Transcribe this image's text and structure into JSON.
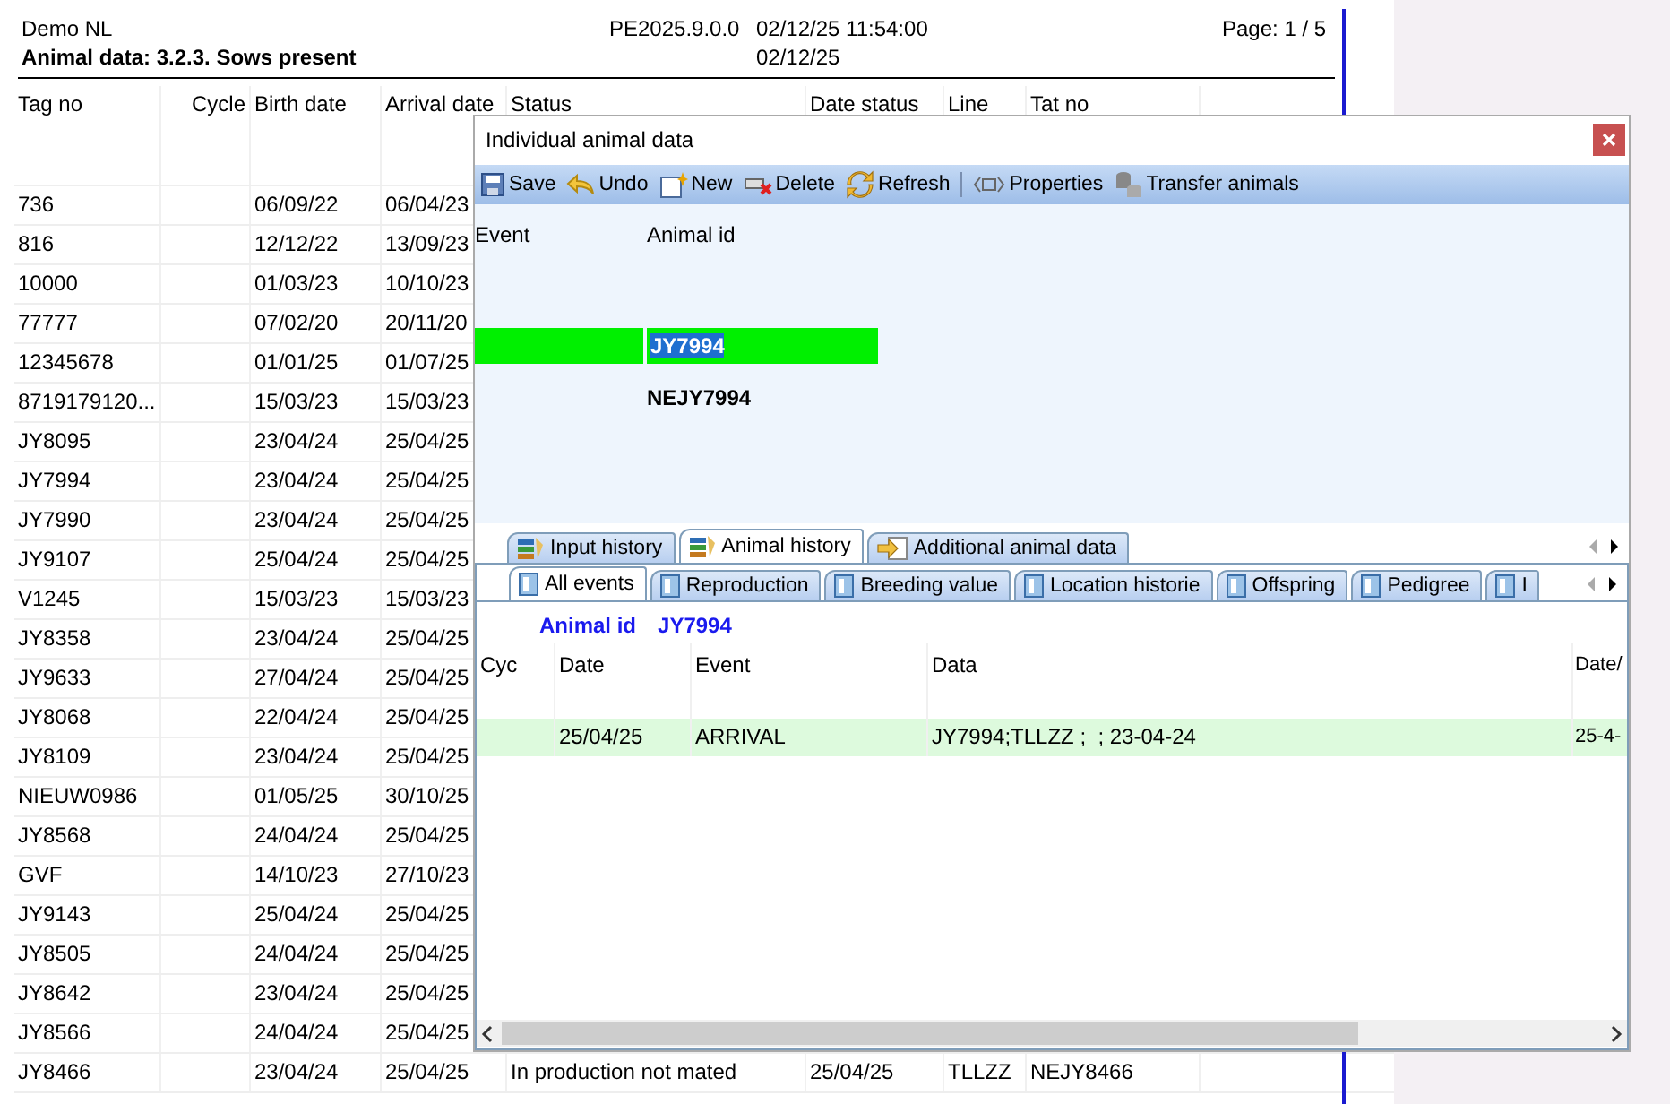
{
  "report": {
    "company": "Demo NL",
    "title": "Animal data: 3.2.3. Sows present",
    "version": "PE2025.9.0.0",
    "printed": "02/12/25 11:54:00",
    "date": "02/12/25",
    "page": "Page: 1 / 5",
    "columns": [
      "Tag no",
      "Cycle",
      "Birth date",
      "Arrival date",
      "Status",
      "Date status",
      "Line",
      "Tat no"
    ],
    "rows": [
      {
        "tag_no": "736",
        "birth_date": "06/09/22",
        "arrival_date": "06/04/23"
      },
      {
        "tag_no": "816",
        "birth_date": "12/12/22",
        "arrival_date": "13/09/23"
      },
      {
        "tag_no": "10000",
        "birth_date": "01/03/23",
        "arrival_date": "10/10/23"
      },
      {
        "tag_no": "77777",
        "birth_date": "07/02/20",
        "arrival_date": "20/11/20"
      },
      {
        "tag_no": "12345678",
        "birth_date": "01/01/25",
        "arrival_date": "01/07/25"
      },
      {
        "tag_no": "8719179120...",
        "birth_date": "15/03/23",
        "arrival_date": "15/03/23"
      },
      {
        "tag_no": "JY8095",
        "birth_date": "23/04/24",
        "arrival_date": "25/04/25"
      },
      {
        "tag_no": "JY7994",
        "birth_date": "23/04/24",
        "arrival_date": "25/04/25"
      },
      {
        "tag_no": "JY7990",
        "birth_date": "23/04/24",
        "arrival_date": "25/04/25"
      },
      {
        "tag_no": "JY9107",
        "birth_date": "25/04/24",
        "arrival_date": "25/04/25"
      },
      {
        "tag_no": "V1245",
        "birth_date": "15/03/23",
        "arrival_date": "15/03/23"
      },
      {
        "tag_no": "JY8358",
        "birth_date": "23/04/24",
        "arrival_date": "25/04/25"
      },
      {
        "tag_no": "JY9633",
        "birth_date": "27/04/24",
        "arrival_date": "25/04/25"
      },
      {
        "tag_no": "JY8068",
        "birth_date": "22/04/24",
        "arrival_date": "25/04/25"
      },
      {
        "tag_no": "JY8109",
        "birth_date": "23/04/24",
        "arrival_date": "25/04/25"
      },
      {
        "tag_no": "NIEUW0986",
        "birth_date": "01/05/25",
        "arrival_date": "30/10/25"
      },
      {
        "tag_no": "JY8568",
        "birth_date": "24/04/24",
        "arrival_date": "25/04/25"
      },
      {
        "tag_no": "GVF",
        "birth_date": "14/10/23",
        "arrival_date": "27/10/23"
      },
      {
        "tag_no": "JY9143",
        "birth_date": "25/04/24",
        "arrival_date": "25/04/25"
      },
      {
        "tag_no": "JY8505",
        "birth_date": "24/04/24",
        "arrival_date": "25/04/25"
      },
      {
        "tag_no": "JY8642",
        "birth_date": "23/04/24",
        "arrival_date": "25/04/25"
      },
      {
        "tag_no": "JY8566",
        "birth_date": "24/04/24",
        "arrival_date": "25/04/25"
      },
      {
        "tag_no": "JY8466",
        "birth_date": "23/04/24",
        "arrival_date": "25/04/25",
        "status": "In production not mated",
        "date_status": "25/04/25",
        "line": "TLLZZ",
        "tat_no": "NEJY8466"
      }
    ]
  },
  "dialog": {
    "title": "Individual animal data",
    "toolbar": [
      {
        "kind": "save",
        "label": "Save",
        "separator_before": false
      },
      {
        "kind": "undo",
        "label": "Undo",
        "separator_before": false
      },
      {
        "kind": "new",
        "label": "New",
        "separator_before": false
      },
      {
        "kind": "delete",
        "label": "Delete",
        "separator_before": false
      },
      {
        "kind": "refresh",
        "label": "Refresh",
        "separator_before": false
      },
      {
        "kind": "properties",
        "label": "Properties",
        "separator_before": true
      },
      {
        "kind": "transfer",
        "label": "Transfer animals",
        "separator_before": false
      }
    ],
    "entry": {
      "columns": [
        "Event",
        "Animal id"
      ],
      "rows": [
        {
          "kind": "input",
          "animal_id": "JY7994"
        },
        {
          "kind": "summary",
          "animal_id": "NEJY7994"
        }
      ]
    },
    "tabs": [
      {
        "kind": "books",
        "label": "Input history",
        "selected": false
      },
      {
        "kind": "books",
        "label": "Animal history",
        "selected": true
      },
      {
        "kind": "arrow",
        "label": "Additional animal data",
        "selected": false
      }
    ],
    "subtabs": [
      {
        "label": "All events",
        "selected": true
      },
      {
        "label": "Reproduction",
        "selected": false
      },
      {
        "label": "Breeding value",
        "selected": false
      },
      {
        "label": "Location historie",
        "selected": false
      },
      {
        "label": "Offspring",
        "selected": false
      },
      {
        "label": "Pedigree",
        "selected": false
      },
      {
        "label": "I",
        "selected": false
      }
    ],
    "history": {
      "animal_label": "Animal id",
      "animal_id": "JY7994",
      "columns": [
        "Cyc",
        "Date",
        "Event",
        "Data",
        "Date/"
      ],
      "rows": [
        {
          "date": "25/04/25",
          "event": "ARRIVAL",
          "data": "JY7994;TLLZZ ;  ; 23-04-24",
          "column_5": "25-4-"
        }
      ]
    }
  }
}
